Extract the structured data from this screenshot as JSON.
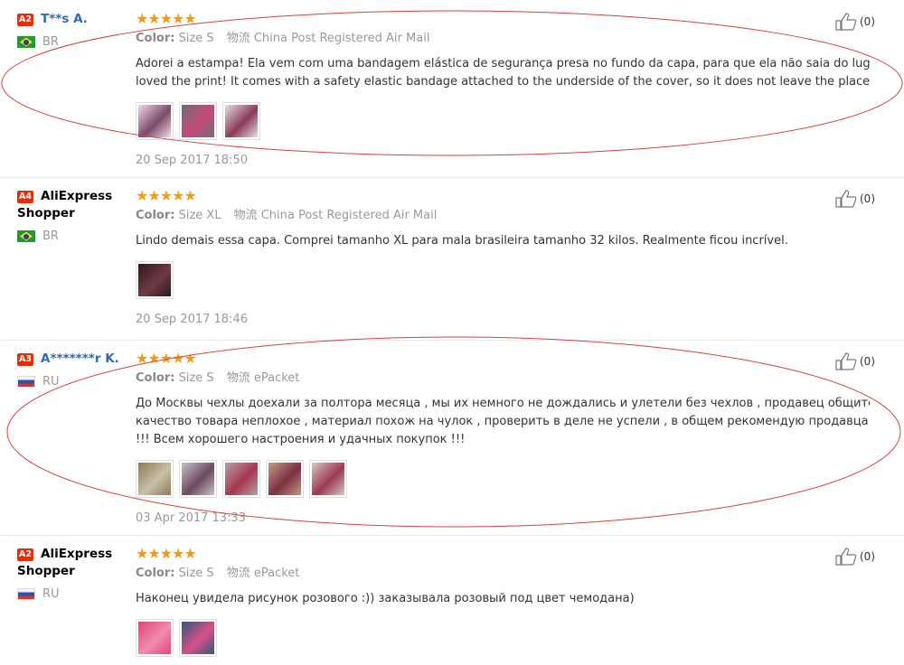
{
  "reviews": [
    {
      "level": "A2",
      "name": "T**s A.",
      "anonymous": false,
      "country": "BR",
      "flag": "br",
      "stars": "★★★★★",
      "color_label": "Color:",
      "color_value": "Size S",
      "shipping_label": "物流",
      "shipping_value": "China Post Registered Air Mail",
      "text_lines": [
        "Adorei a estampa! Ela vem com uma bandagem elástica de segurança presa no fundo da capa, para que ela não saia do lugar. I",
        "loved the print! It comes with a safety elastic bandage attached to the underside of the cover, so it does not leave the place."
      ],
      "thumb_colors": [
        [
          "#f3d9e8",
          "#7a4a6a"
        ],
        [
          "#6b6f76",
          "#c7497a"
        ],
        [
          "#e6dfe3",
          "#8a3a5a"
        ]
      ],
      "date": "20 Sep 2017 18:50",
      "helpful": "(0)"
    },
    {
      "level": "A4",
      "name": "AliExpress Shopper",
      "anonymous": true,
      "country": "BR",
      "flag": "br",
      "stars": "★★★★★",
      "color_label": "Color:",
      "color_value": "Size XL",
      "shipping_label": "物流",
      "shipping_value": "China Post Registered Air Mail",
      "text_lines": [
        "Lindo demais essa capa. Comprei tamanho XL para mala brasileira tamanho 32 kilos. Realmente ficou incrível."
      ],
      "thumb_colors": [
        [
          "#2b1a1c",
          "#6e3a44"
        ]
      ],
      "date": "20 Sep 2017 18:46",
      "helpful": "(0)"
    },
    {
      "level": "A3",
      "name": "A*******r K.",
      "anonymous": false,
      "country": "RU",
      "flag": "ru",
      "stars": "★★★★★",
      "color_label": "Color:",
      "color_value": "Size S",
      "shipping_label": "物流",
      "shipping_value": "ePacket",
      "text_lines": [
        "До Москвы чехлы доехали за полтора месяца , мы их немного не дождались и улетели без чехлов , продавец общительный ,",
        "качество товара неплохое , материал похож на чулок , проверить в деле не успели , в общем рекомендую продавца и товар",
        "!!! Всем хорошего настроения и удачных покупок !!!"
      ],
      "thumb_colors": [
        [
          "#8c7a55",
          "#c8c0a8"
        ],
        [
          "#c9c2c8",
          "#6a4a60"
        ],
        [
          "#b0a3a8",
          "#a8364e"
        ],
        [
          "#c49b86",
          "#7a3040"
        ],
        [
          "#d8c8c0",
          "#9a3a52"
        ]
      ],
      "date": "03 Apr 2017 13:33",
      "helpful": "(0)"
    },
    {
      "level": "A2",
      "name": "AliExpress Shopper",
      "anonymous": true,
      "country": "RU",
      "flag": "ru",
      "stars": "★★★★★",
      "color_label": "Color:",
      "color_value": "Size S",
      "shipping_label": "物流",
      "shipping_value": "ePacket",
      "text_lines": [
        "Наконец увидела рисунок розового :)) заказывала розовый под цвет чемодана)"
      ],
      "thumb_colors": [
        [
          "#e0457a",
          "#f28bb0"
        ],
        [
          "#2f5a78",
          "#d8508a"
        ]
      ],
      "date": "",
      "helpful": "(0)"
    }
  ],
  "annotation_color": "#d8423c"
}
